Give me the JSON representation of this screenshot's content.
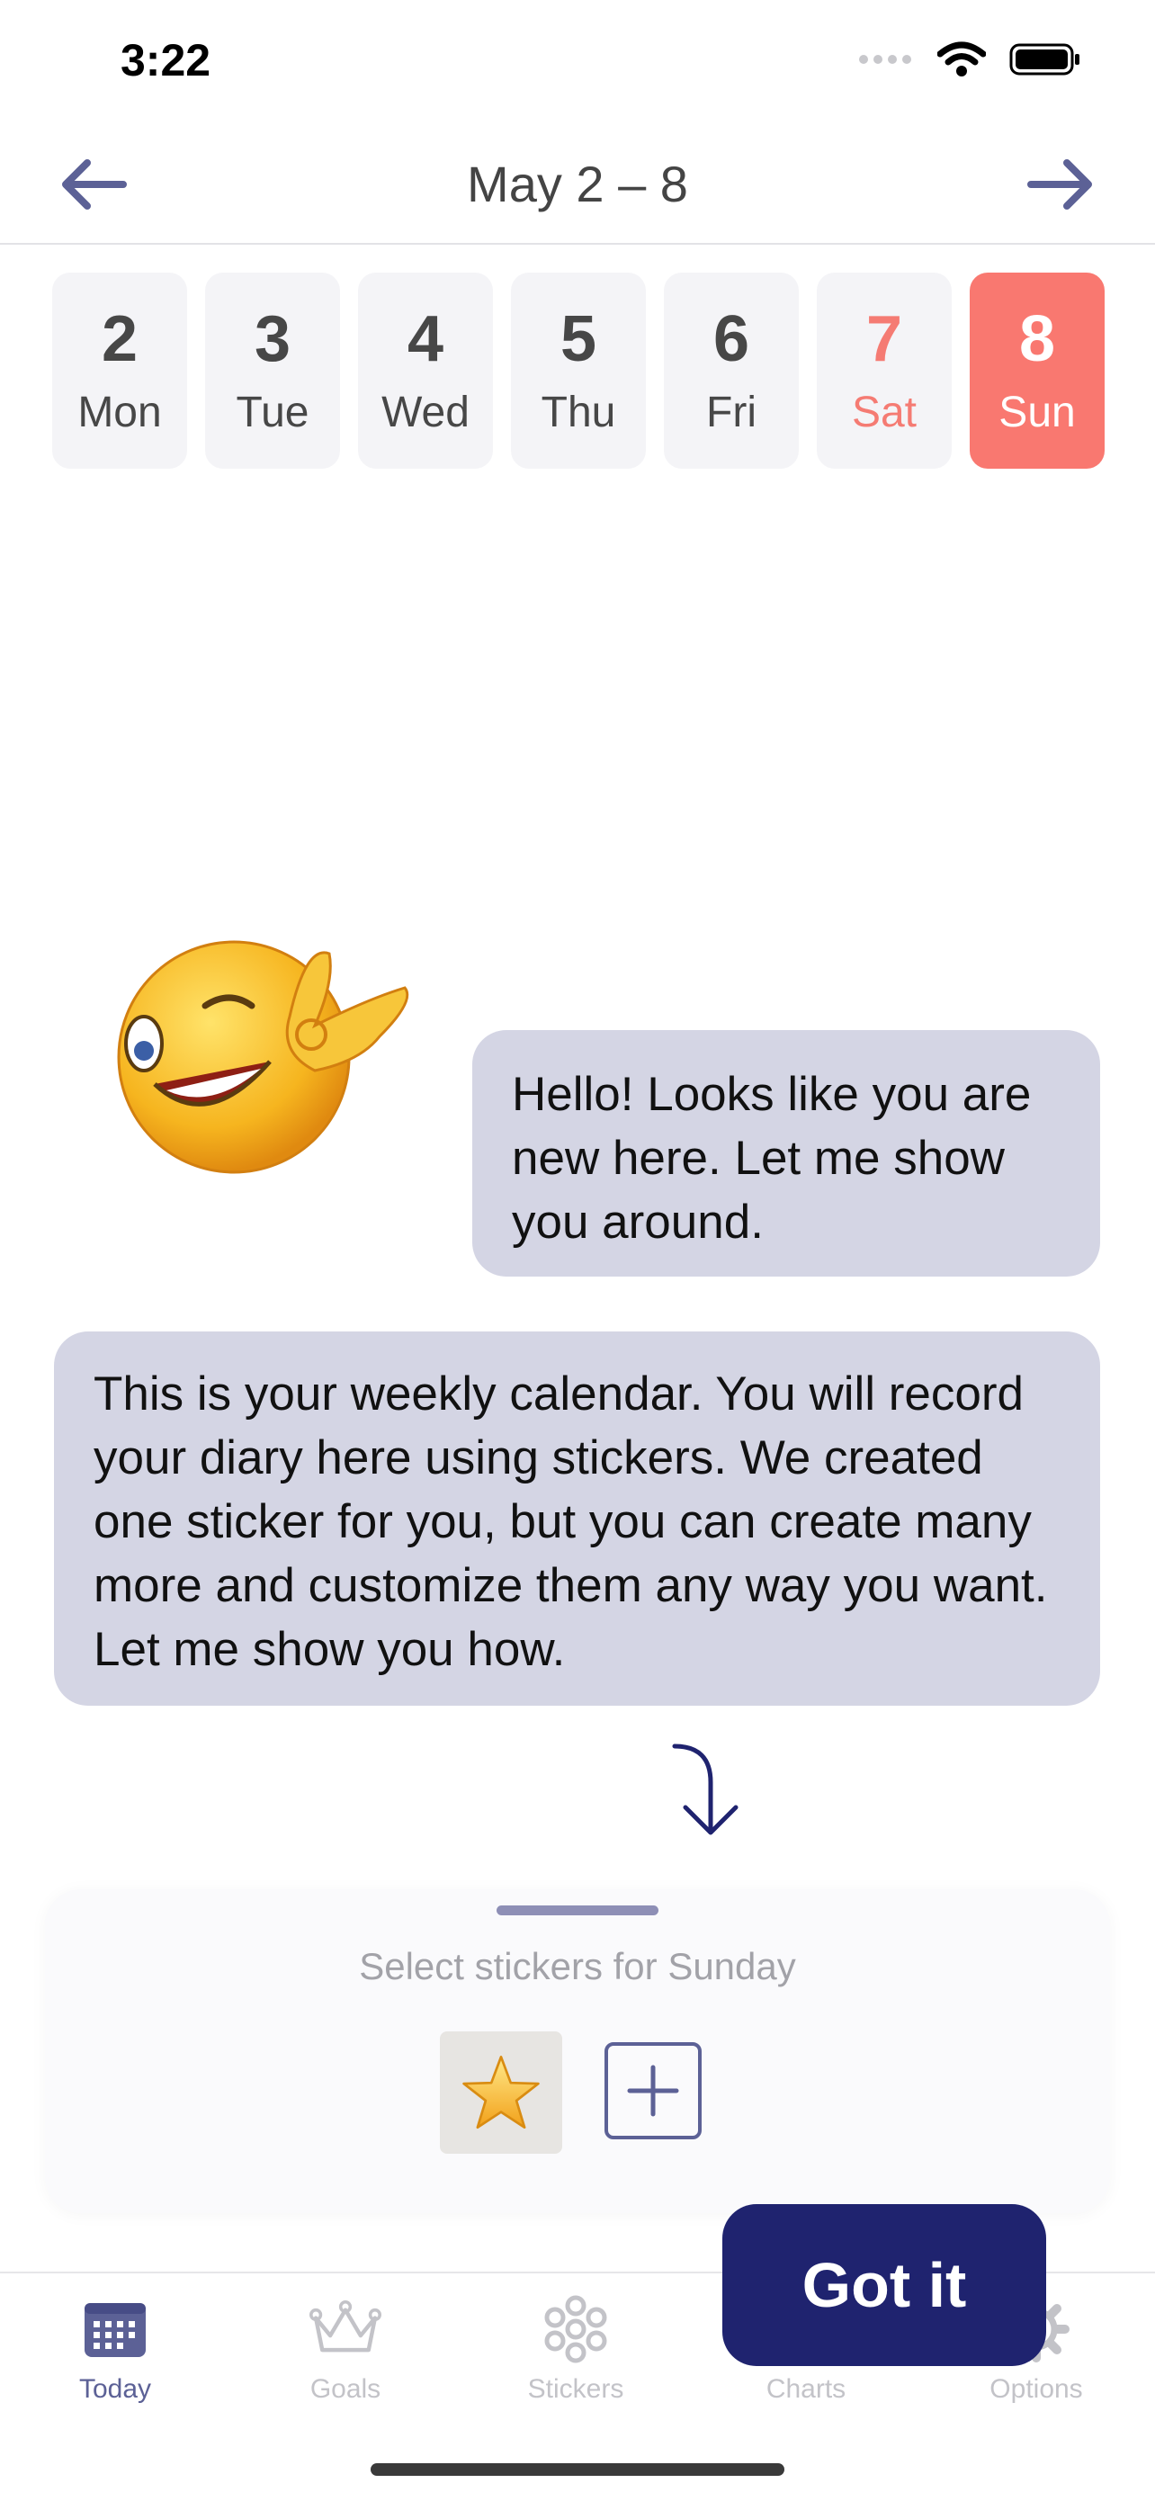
{
  "status_bar": {
    "time": "3:22"
  },
  "header": {
    "title": "May 2 – 8"
  },
  "week": [
    {
      "num": "2",
      "weekday": "Mon",
      "state": "normal"
    },
    {
      "num": "3",
      "weekday": "Tue",
      "state": "normal"
    },
    {
      "num": "4",
      "weekday": "Wed",
      "state": "normal"
    },
    {
      "num": "5",
      "weekday": "Thu",
      "state": "normal"
    },
    {
      "num": "6",
      "weekday": "Fri",
      "state": "normal"
    },
    {
      "num": "7",
      "weekday": "Sat",
      "state": "weekend"
    },
    {
      "num": "8",
      "weekday": "Sun",
      "state": "selected"
    }
  ],
  "tutorial": {
    "message_1": "Hello! Looks like you are new here. Let me show you around.",
    "message_2": "This is your weekly calendar. You will record your diary here using stickers. We created one sticker for you, but you can create many more and customize them any way you want. Let me show you how."
  },
  "sticker_panel": {
    "label": "Select stickers for Sunday",
    "stickers": [
      {
        "icon": "star-icon"
      }
    ]
  },
  "tabs": [
    {
      "label": "Today",
      "icon": "calendar-icon",
      "active": true
    },
    {
      "label": "Goals",
      "icon": "crown-icon",
      "active": false
    },
    {
      "label": "Stickers",
      "icon": "flower-icon",
      "active": false
    },
    {
      "label": "Charts",
      "icon": "chart-icon",
      "active": false
    },
    {
      "label": "Options",
      "icon": "gear-icon",
      "active": false
    }
  ],
  "got_it_label": "Got it",
  "colors": {
    "accent": "#5c6196",
    "selected_day": "#f97870",
    "weekend_text": "#f57b73",
    "bubble": "#d4d5e4",
    "primary_button": "#1f236f"
  }
}
